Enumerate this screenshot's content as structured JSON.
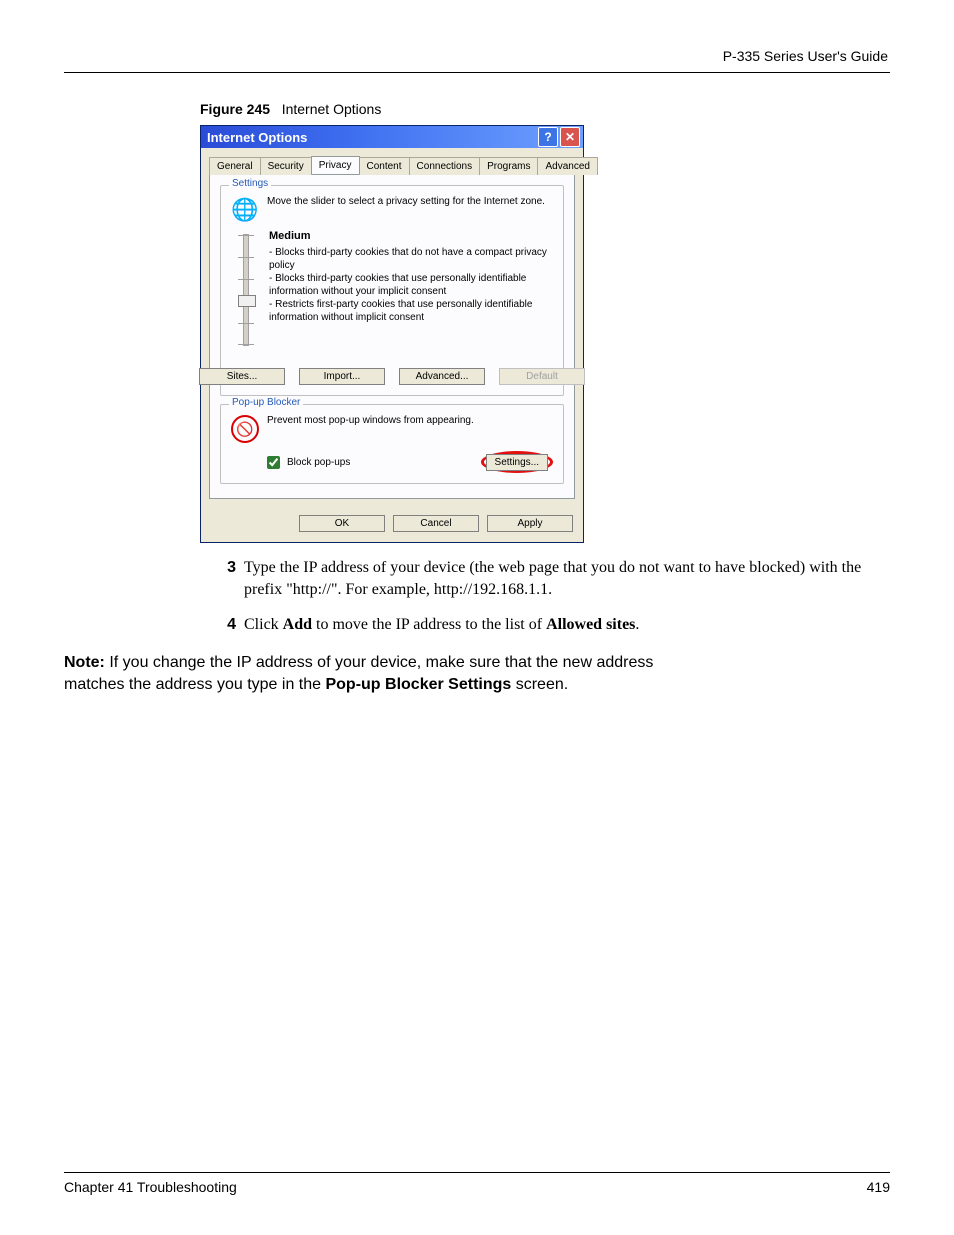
{
  "header": {
    "guide": "P-335 Series User's Guide"
  },
  "figure": {
    "label": "Figure 245",
    "caption": "Internet Options"
  },
  "dialog": {
    "title": "Internet Options",
    "tabs": [
      "General",
      "Security",
      "Privacy",
      "Content",
      "Connections",
      "Programs",
      "Advanced"
    ],
    "selected_tab_index": 2,
    "settings": {
      "legend": "Settings",
      "instruction": "Move the slider to select a privacy setting for the Internet zone.",
      "level": "Medium",
      "bullets": [
        "- Blocks third-party cookies that do not have a compact privacy policy",
        "- Blocks third-party cookies that use personally identifiable information without your implicit consent",
        "- Restricts first-party cookies that use personally identifiable information without implicit consent"
      ],
      "buttons": {
        "sites": "Sites...",
        "import": "Import...",
        "advanced": "Advanced...",
        "default": "Default"
      }
    },
    "popup": {
      "legend": "Pop-up Blocker",
      "text": "Prevent most pop-up windows from appearing.",
      "checkbox_label": "Block pop-ups",
      "checkbox_checked": true,
      "settings_button": "Settings..."
    },
    "footer": {
      "ok": "OK",
      "cancel": "Cancel",
      "apply": "Apply"
    }
  },
  "steps": {
    "s3": "Type the IP address of your device (the web page that you do not want to have blocked) with the prefix \"http://\". For example, http://192.168.1.1.",
    "s4_pre": "Click ",
    "s4_add": "Add",
    "s4_mid": " to move the IP address to the list of ",
    "s4_allowed": "Allowed sites",
    "s4_end": "."
  },
  "note": {
    "label": "Note:",
    "line1": " If you change the IP address of your device, make sure that the new address",
    "line2": "matches the address you type in the ",
    "bold": "Pop-up Blocker Settings",
    "line3": " screen."
  },
  "footer": {
    "chapter": "Chapter 41 Troubleshooting",
    "page": "419"
  }
}
